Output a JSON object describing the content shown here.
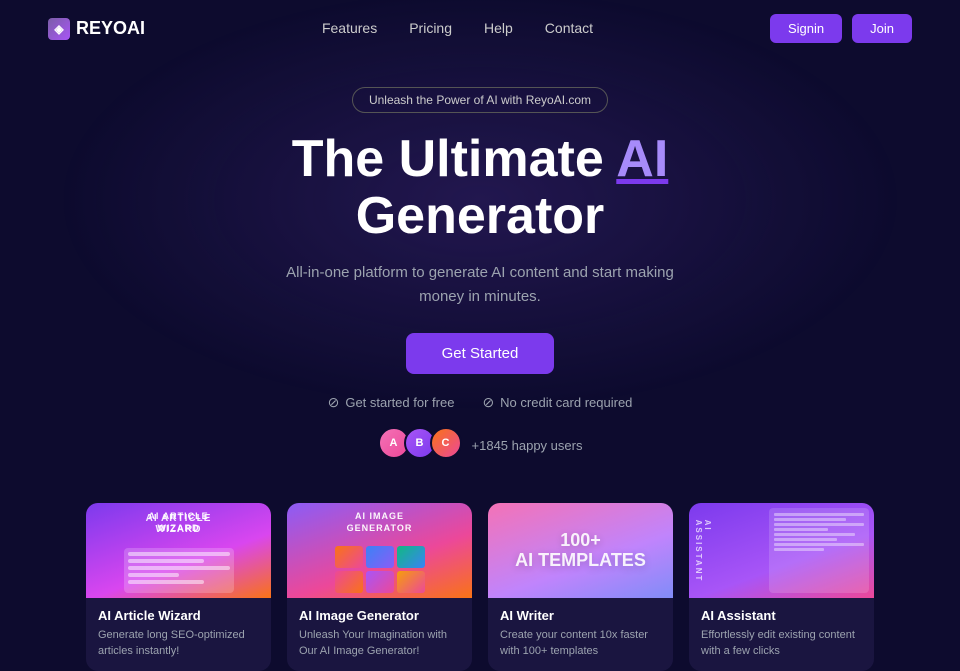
{
  "meta": {
    "title": "ReyoAI - The Ultimate AI Generator"
  },
  "logo": {
    "text": "REYOAI",
    "icon_symbol": "◈"
  },
  "nav": {
    "links": [
      {
        "label": "Features",
        "href": "#"
      },
      {
        "label": "Pricing",
        "href": "#"
      },
      {
        "label": "Help",
        "href": "#"
      },
      {
        "label": "Contact",
        "href": "#"
      }
    ],
    "signin_label": "Signin",
    "join_label": "Join"
  },
  "hero": {
    "badge": "Unleash the Power of AI with ReyoAI.com",
    "title_prefix": "The Ultimate ",
    "title_highlight": "AI",
    "title_suffix": "Generator",
    "subtitle": "All-in-one platform to generate AI content and start making\nmoney in minutes.",
    "cta_label": "Get Started",
    "trust_item1": "Get started for free",
    "trust_item2": "No credit card required",
    "happy_count": "+1845 happy users"
  },
  "cards": [
    {
      "id": "article-wizard",
      "name": "AI Article Wizard",
      "description": "Generate long SEO-optimized articles instantly!"
    },
    {
      "id": "image-generator",
      "name": "AI Image Generator",
      "description": "Unleash Your Imagination with Our AI Image Generator!"
    },
    {
      "id": "writer",
      "name": "AI Writer",
      "description": "Create your content 10x faster with 100+ templates"
    },
    {
      "id": "assistant",
      "name": "AI Assistant",
      "description": "Effortlessly edit existing content with a few clicks"
    }
  ],
  "colors": {
    "accent": "#7c3aed",
    "bg": "#0d0b2e",
    "card_bg": "#1a1540"
  }
}
